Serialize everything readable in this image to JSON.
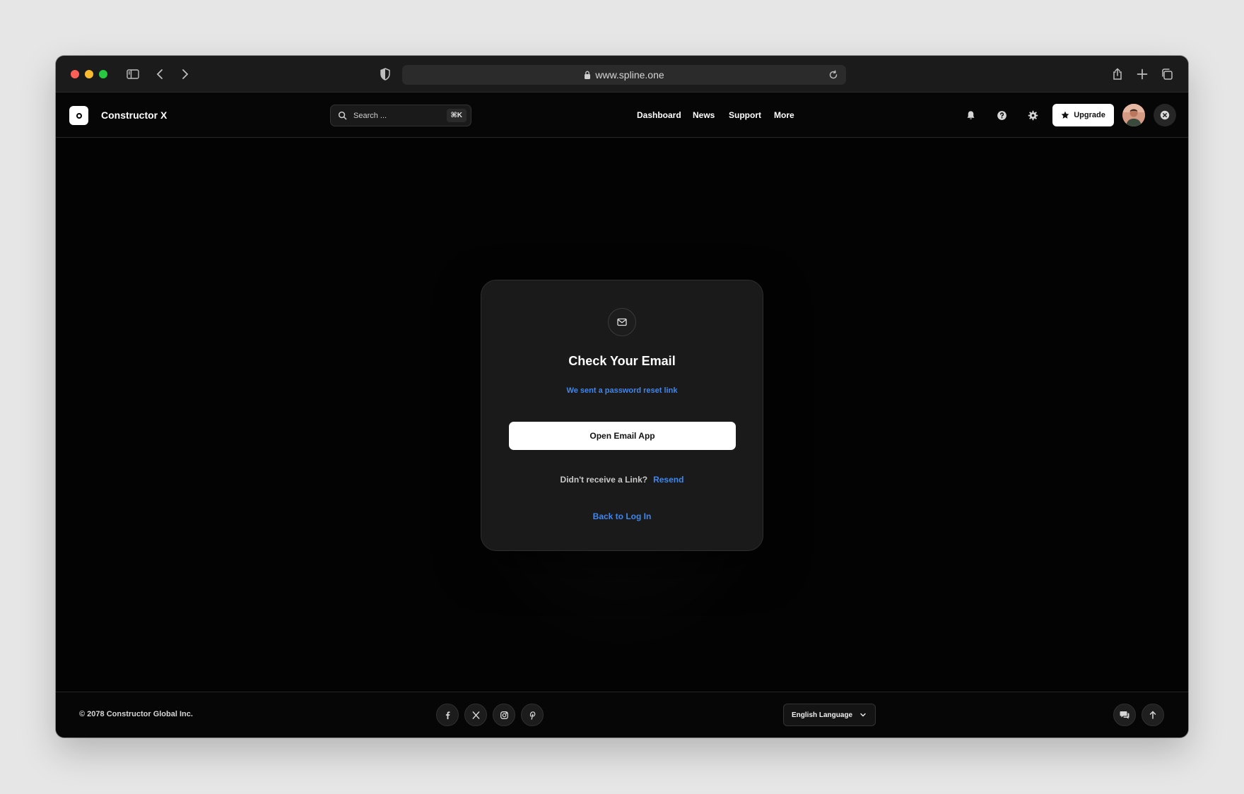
{
  "browser": {
    "url": "www.spline.one"
  },
  "header": {
    "brand": "Constructor X",
    "search_placeholder": "Search ...",
    "search_shortcut": "⌘K",
    "nav": [
      {
        "label": "Dashboard"
      },
      {
        "label": "News"
      },
      {
        "label": "Support"
      },
      {
        "label": "More"
      }
    ],
    "upgrade_label": "Upgrade"
  },
  "card": {
    "title": "Check Your Email",
    "subtitle": "We sent a password reset link",
    "open_button": "Open Email App",
    "resend_question": "Didn't receive a Link?",
    "resend_link": "Resend",
    "back_link": "Back to Log In"
  },
  "footer": {
    "copyright": "© 2078 Constructor Global Inc.",
    "language": "English Language",
    "social": [
      "facebook-icon",
      "x-icon",
      "instagram-icon",
      "pinterest-icon"
    ]
  },
  "colors": {
    "accent_link": "#3f86ee",
    "background": "#030303",
    "card": "#1a1a1a"
  }
}
